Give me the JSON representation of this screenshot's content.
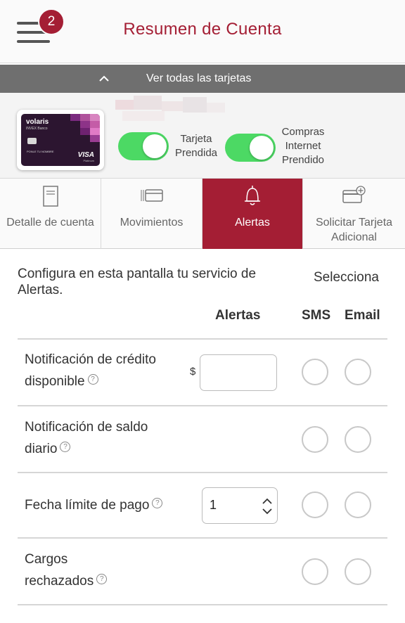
{
  "header": {
    "title": "Resumen de Cuenta",
    "menu_icon": "hamburger-menu-icon",
    "notification_count": "2"
  },
  "cards_bar": {
    "label": "Ver todas las tarjetas",
    "icon": "chevron-up-icon"
  },
  "card": {
    "brand": "volaris",
    "bank": "INVEX Banco",
    "holder": "PONLE TU NOMBRE",
    "network": "VISA",
    "tier": "Platinum",
    "toggles": [
      {
        "label": "Tarjeta Prendida",
        "on": true
      },
      {
        "label": "Compras Internet Prendido",
        "on": true
      }
    ]
  },
  "tabs": [
    {
      "label": "Detalle de cuenta",
      "icon": "document-icon",
      "active": false
    },
    {
      "label": "Movimientos",
      "icon": "cards-stack-icon",
      "active": false
    },
    {
      "label": "Alertas",
      "icon": "bell-icon",
      "active": true
    },
    {
      "label": "Solicitar Tarjeta Adicional",
      "icon": "card-add-icon",
      "active": false
    }
  ],
  "content": {
    "intro": "Configura en esta pantalla tu servicio de Alertas.",
    "select_label": "Selecciona",
    "columns": {
      "alerts": "Alertas",
      "sms": "SMS",
      "email": "Email"
    },
    "currency_symbol": "$",
    "rows": [
      {
        "label_line1": "Notificación de crédito",
        "label_line2": "disponible",
        "control": "amount-input",
        "value": ""
      },
      {
        "label_line1": "Notificación de saldo",
        "label_line2": "diario",
        "control": "none"
      },
      {
        "label_line1": "Fecha límite de pago",
        "label_line2": "",
        "control": "stepper",
        "value": "1"
      },
      {
        "label_line1": "Cargos",
        "label_line2": "rechazados",
        "control": "none"
      }
    ],
    "help_glyph": "?"
  },
  "colors": {
    "brand": "#a41e34",
    "toggle_on": "#4cd964",
    "bar_gray": "#6f6f6f"
  }
}
